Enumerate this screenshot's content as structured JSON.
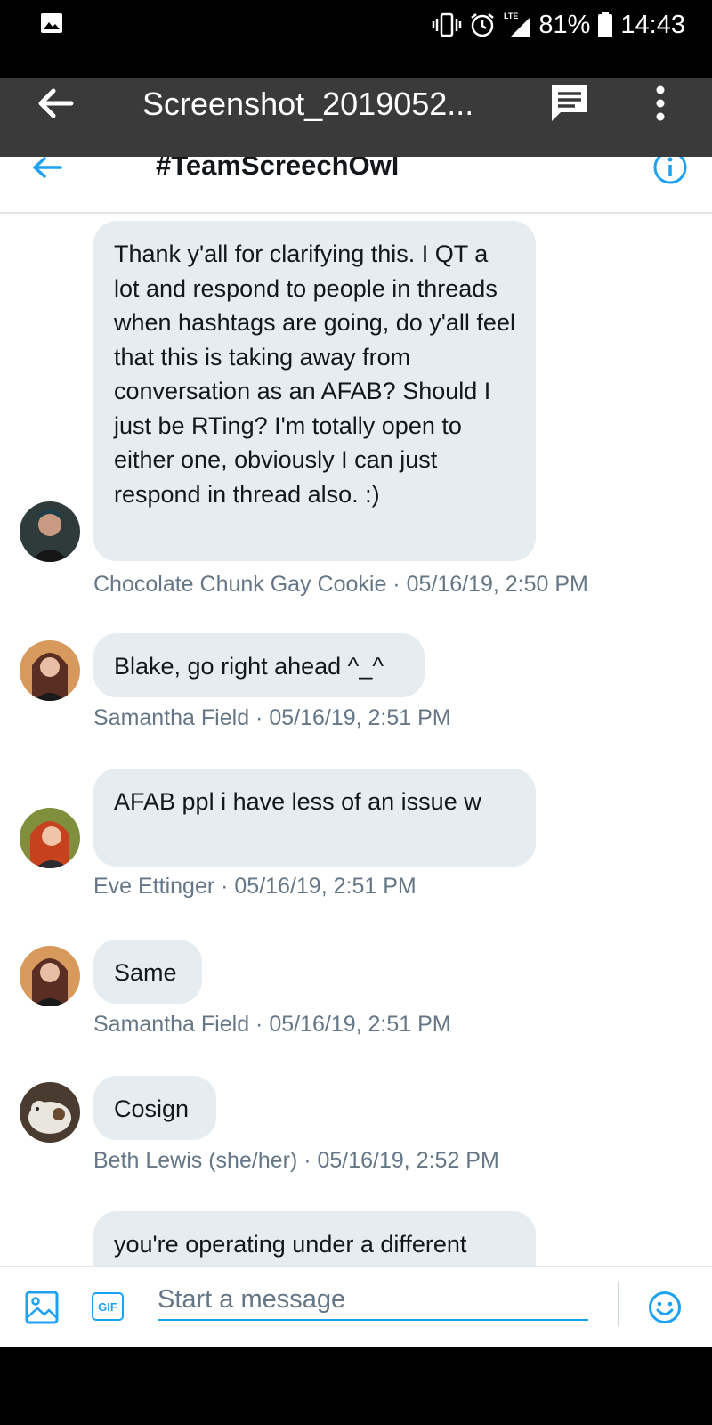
{
  "status_bar": {
    "battery": "81%",
    "time": "14:43",
    "network": "LTE"
  },
  "viewer": {
    "title": "Screenshot_2019052..."
  },
  "header": {
    "title": "#TeamScreechOwl"
  },
  "messages": [
    {
      "text": "Thank y'all for clarifying this. I QT a lot and respond to people in threads when hashtags are going, do y'all feel that this is taking away from conversation as an AFAB? Should I just be RTing? I'm totally open to either one, obviously I can just respond in thread also. :)",
      "meta": "Chocolate Chunk Gay Cookie · 05/16/19, 2:50 PM",
      "avatar_color": "#2e3b3a"
    },
    {
      "text": "Blake, go right ahead ^_^",
      "meta": "Samantha Field · 05/16/19, 2:51 PM",
      "avatar_color": "#5a2e22"
    },
    {
      "text": "AFAB ppl i have less of an issue w",
      "meta": "Eve Ettinger · 05/16/19, 2:51 PM",
      "avatar_color": "#c6411e"
    },
    {
      "text": "Same",
      "meta": "Samantha Field · 05/16/19, 2:51 PM",
      "avatar_color": "#5a2e22"
    },
    {
      "text": "Cosign",
      "meta": "Beth Lewis (she/her) · 05/16/19, 2:52 PM",
      "avatar_color": "#4a3b30"
    },
    {
      "text": "you're operating under a different",
      "meta": "",
      "avatar_color": ""
    }
  ],
  "composer": {
    "placeholder": "Start a message",
    "gif_label": "GIF"
  },
  "colors": {
    "accent": "#1da1f2",
    "bubble": "#e6ecf0",
    "meta_text": "#657786"
  }
}
